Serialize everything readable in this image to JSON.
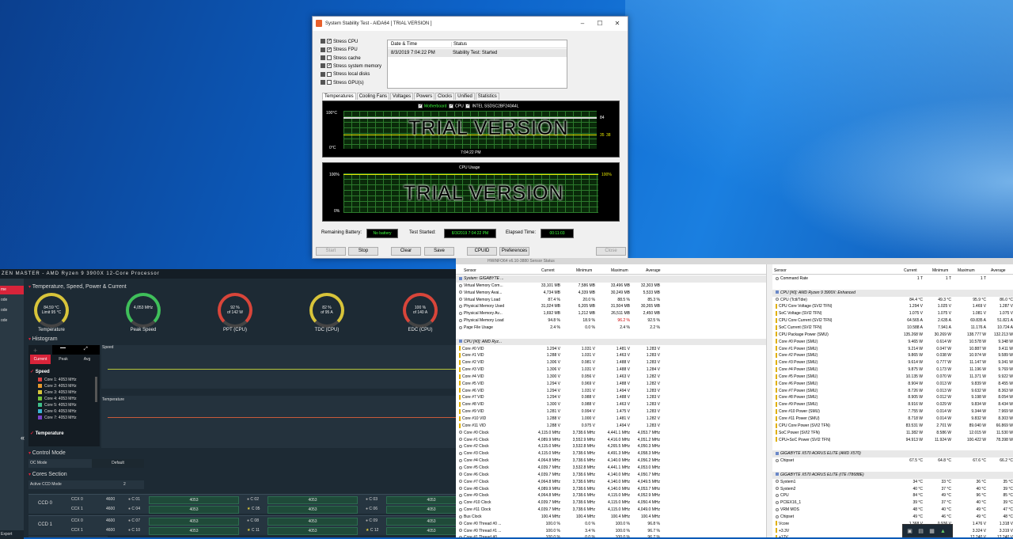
{
  "aida": {
    "title": "System Stability Test - AIDA64  [ TRIAL VERSION ]",
    "stress": [
      {
        "label": "Stress CPU",
        "checked": true
      },
      {
        "label": "Stress FPU",
        "checked": true
      },
      {
        "label": "Stress cache",
        "checked": false
      },
      {
        "label": "Stress system memory",
        "checked": true
      },
      {
        "label": "Stress local disks",
        "checked": false
      },
      {
        "label": "Stress GPU(s)",
        "checked": false
      }
    ],
    "log_headers": [
      "Date & Time",
      "Status"
    ],
    "log_rows": [
      [
        "8/3/2019 7:04:22 PM",
        "Stability Test: Started"
      ]
    ],
    "tabs": [
      "Temperatures",
      "Cooling Fans",
      "Voltages",
      "Powers",
      "Clocks",
      "Unified",
      "Statistics"
    ],
    "temp_legend": [
      "Motherboard",
      "CPU",
      "INTEL SSDSC2BF240A4L"
    ],
    "temp_top": "100°C",
    "temp_bottom": "0°C",
    "temp_time": "7:04:22 PM",
    "temp_vals": [
      "84",
      "35",
      "38"
    ],
    "trial": "TRIAL VERSION",
    "cpu_title": "CPU Usage",
    "cpu_top": "100%",
    "cpu_bottom": "0%",
    "cpu_right": "100%",
    "battery_label": "Remaining Battery:",
    "battery_val": "No battery",
    "started_label": "Test Started:",
    "started_val": "8/3/2019 7:04:22 PM",
    "elapsed_label": "Elapsed Time:",
    "elapsed_val": "00:11:03",
    "buttons": [
      "Start",
      "Stop",
      "Clear",
      "Save",
      "CPUID",
      "Preferences",
      "Close"
    ]
  },
  "rm": {
    "title": "ZEN MASTER  -  AMD Ryzen 9 3900X 12-Core Processor",
    "side": [
      "me",
      "ode",
      "ode",
      "ode"
    ],
    "side_bottom": "Export",
    "section_temp": "Temperature, Speed, Power & Current",
    "gauges": [
      {
        "v1": "84.59 °C",
        "v2": "Limit 95 °C",
        "cap": "Temperature",
        "color": "#d8c43a"
      },
      {
        "v1": "4,053  MHz",
        "v2": "",
        "cap": "Peak Speed",
        "color": "#3fbf5a"
      },
      {
        "v1": "92 %",
        "v2": "of 142 W",
        "cap": "PPT (CPU)",
        "color": "#d8453a"
      },
      {
        "v1": "82 %",
        "v2": "of 95 A",
        "cap": "TDC (CPU)",
        "color": "#d8c43a"
      },
      {
        "v1": "100 %",
        "v2": "of 140 A",
        "cap": "EDC (CPU)",
        "color": "#d8453a"
      }
    ],
    "section_hist": "Histogram",
    "hist_tabs": [
      "Current",
      "Peak",
      "Avg"
    ],
    "speed_label": "Speed",
    "cores": [
      {
        "name": "Core 1: 4053 MHz",
        "color": "#d94141"
      },
      {
        "name": "Core 2: 4053 MHz",
        "color": "#e69a2e"
      },
      {
        "name": "Core 3: 4053 MHz",
        "color": "#d9c53b"
      },
      {
        "name": "Core 4: 4053 MHz",
        "color": "#74c23c"
      },
      {
        "name": "Core 5: 4053 MHz",
        "color": "#3fbf8a"
      },
      {
        "name": "Core 6: 4053 MHz",
        "color": "#3ab5d1"
      },
      {
        "name": "Core 7: 4053 MHz",
        "color": "#7a45c9"
      }
    ],
    "temperature_label": "Temperature",
    "graph_speed": "Speed",
    "graph_temp": "Temperature",
    "section_control": "Control Mode",
    "oc_mode": "OC Mode",
    "oc_val": "Default",
    "section_cores": "Cores Section",
    "active_ccd": "Active CCD Mode",
    "active_ccd_val": "2",
    "ccd": [
      {
        "name": "CCD 0",
        "rows": [
          {
            "ccx": "CCX 0",
            "mhz": "4600",
            "cells": [
              [
                "C 01",
                "4053"
              ],
              [
                "C 02",
                "4053"
              ],
              [
                "C 03",
                "4053"
              ]
            ]
          },
          {
            "ccx": "CCX 1",
            "mhz": "4600",
            "cells": [
              [
                "C 04",
                "4053"
              ],
              [
                "C 05",
                "4053"
              ],
              [
                "C 06",
                "4053"
              ]
            ]
          }
        ]
      },
      {
        "name": "CCD 1",
        "rows": [
          {
            "ccx": "CCX 0",
            "mhz": "4600",
            "cells": [
              [
                "C 07",
                "4053"
              ],
              [
                "C 08",
                "4053"
              ],
              [
                "C 09",
                "4053"
              ]
            ]
          },
          {
            "ccx": "CCX 1",
            "mhz": "4600",
            "cells": [
              [
                "C 10",
                "4053"
              ],
              [
                "C 11",
                "4053"
              ],
              [
                "C 12",
                "4053"
              ]
            ]
          }
        ]
      }
    ]
  },
  "hw": {
    "title": "HWiNFO64 v6.10-3880 Sensor Status",
    "headers": [
      "Sensor",
      "Current",
      "Minimum",
      "Maximum",
      "Average"
    ],
    "left": [
      {
        "g": true,
        "n": "System: GIGABYTE ..."
      },
      {
        "i": "c",
        "n": "Virtual Memory Com...",
        "v": [
          "33,101 MB",
          "7,586 MB",
          "33,496 MB",
          "32,303 MB"
        ]
      },
      {
        "i": "c",
        "n": "Virtual Memory Avai...",
        "v": [
          "4,734 MB",
          "4,339 MB",
          "30,249 MB",
          "5,533 MB"
        ]
      },
      {
        "i": "c",
        "n": "Virtual Memory Load",
        "v": [
          "87.4 %",
          "20.0 %",
          "88.5 %",
          "85.3 %"
        ]
      },
      {
        "i": "c",
        "n": "Physical Memory Used",
        "v": [
          "31,024 MB",
          "6,205 MB",
          "31,504 MB",
          "30,265 MB"
        ]
      },
      {
        "i": "c",
        "n": "Physical Memory Av...",
        "v": [
          "1,692 MB",
          "1,212 MB",
          "26,511 MB",
          "2,450 MB"
        ]
      },
      {
        "i": "c",
        "n": "Physical Memory Load",
        "v": [
          "94.8 %",
          "18.9 %",
          "96.2 %",
          "92.5 %"
        ],
        "red": 2
      },
      {
        "i": "c",
        "n": "Page File Usage",
        "v": [
          "2.4 %",
          "0.0 %",
          "2.4 %",
          "2.2 %"
        ]
      },
      {
        "s": true
      },
      {
        "g": true,
        "n": "CPU [#0]: AMD Ryz..."
      },
      {
        "i": "y",
        "n": "Core #0 VID",
        "v": [
          "1.294 V",
          "1.031 V",
          "1.481 V",
          "1.283 V"
        ]
      },
      {
        "i": "y",
        "n": "Core #1 VID",
        "v": [
          "1.288 V",
          "1.031 V",
          "1.463 V",
          "1.283 V"
        ]
      },
      {
        "i": "y",
        "n": "Core #2 VID",
        "v": [
          "1.306 V",
          "0.981 V",
          "1.488 V",
          "1.283 V"
        ]
      },
      {
        "i": "y",
        "n": "Core #3 VID",
        "v": [
          "1.306 V",
          "1.031 V",
          "1.488 V",
          "1.284 V"
        ]
      },
      {
        "i": "y",
        "n": "Core #4 VID",
        "v": [
          "1.300 V",
          "0.956 V",
          "1.463 V",
          "1.282 V"
        ]
      },
      {
        "i": "y",
        "n": "Core #5 VID",
        "v": [
          "1.294 V",
          "0.969 V",
          "1.488 V",
          "1.282 V"
        ]
      },
      {
        "i": "y",
        "n": "Core #6 VID",
        "v": [
          "1.294 V",
          "1.031 V",
          "1.494 V",
          "1.283 V"
        ]
      },
      {
        "i": "y",
        "n": "Core #7 VID",
        "v": [
          "1.294 V",
          "0.988 V",
          "1.488 V",
          "1.283 V"
        ]
      },
      {
        "i": "y",
        "n": "Core #8 VID",
        "v": [
          "1.300 V",
          "0.988 V",
          "1.463 V",
          "1.283 V"
        ]
      },
      {
        "i": "y",
        "n": "Core #9 VID",
        "v": [
          "1.281 V",
          "0.994 V",
          "1.475 V",
          "1.283 V"
        ]
      },
      {
        "i": "y",
        "n": "Core #10 VID",
        "v": [
          "1.288 V",
          "1.000 V",
          "1.481 V",
          "1.282 V"
        ]
      },
      {
        "i": "y",
        "n": "Core #11 VID",
        "v": [
          "1.288 V",
          "0.975 V",
          "1.494 V",
          "1.283 V"
        ]
      },
      {
        "i": "c",
        "n": "Core #0 Clock",
        "v": [
          "4,115.0 MHz",
          "3,738.6 MHz",
          "4,441.1 MHz",
          "4,053.7 MHz"
        ]
      },
      {
        "i": "c",
        "n": "Core #1 Clock",
        "v": [
          "4,089.9 MHz",
          "3,552.9 MHz",
          "4,416.0 MHz",
          "4,051.2 MHz"
        ]
      },
      {
        "i": "c",
        "n": "Core #2 Clock",
        "v": [
          "4,115.0 MHz",
          "3,532.8 MHz",
          "4,265.5 MHz",
          "4,050.3 MHz"
        ]
      },
      {
        "i": "c",
        "n": "Core #3 Clock",
        "v": [
          "4,115.0 MHz",
          "3,738.6 MHz",
          "4,491.3 MHz",
          "4,058.3 MHz"
        ]
      },
      {
        "i": "c",
        "n": "Core #4 Clock",
        "v": [
          "4,064.8 MHz",
          "3,738.6 MHz",
          "4,140.0 MHz",
          "4,056.2 MHz"
        ]
      },
      {
        "i": "c",
        "n": "Core #5 Clock",
        "v": [
          "4,039.7 MHz",
          "3,532.8 MHz",
          "4,441.1 MHz",
          "4,053.0 MHz"
        ]
      },
      {
        "i": "c",
        "n": "Core #6 Clock",
        "v": [
          "4,039.7 MHz",
          "3,738.6 MHz",
          "4,140.0 MHz",
          "4,050.7 MHz"
        ]
      },
      {
        "i": "c",
        "n": "Core #7 Clock",
        "v": [
          "4,064.8 MHz",
          "3,738.6 MHz",
          "4,140.0 MHz",
          "4,049.5 MHz"
        ]
      },
      {
        "i": "c",
        "n": "Core #8 Clock",
        "v": [
          "4,089.9 MHz",
          "3,738.6 MHz",
          "4,140.0 MHz",
          "4,053.7 MHz"
        ]
      },
      {
        "i": "c",
        "n": "Core #9 Clock",
        "v": [
          "4,064.8 MHz",
          "3,738.6 MHz",
          "4,115.0 MHz",
          "4,052.9 MHz"
        ]
      },
      {
        "i": "c",
        "n": "Core #10 Clock",
        "v": [
          "4,039.7 MHz",
          "3,738.6 MHz",
          "4,115.0 MHz",
          "4,050.4 MHz"
        ]
      },
      {
        "i": "c",
        "n": "Core #11 Clock",
        "v": [
          "4,039.7 MHz",
          "3,738.6 MHz",
          "4,115.0 MHz",
          "4,049.0 MHz"
        ]
      },
      {
        "i": "c",
        "n": "Bus Clock",
        "v": [
          "100.4 MHz",
          "100.4 MHz",
          "100.4 MHz",
          "100.4 MHz"
        ]
      },
      {
        "i": "c",
        "n": "Core #0 Thread #0 ...",
        "v": [
          "100.0 %",
          "0.0 %",
          "100.0 %",
          "96.8 %"
        ]
      },
      {
        "i": "c",
        "n": "Core #0 Thread #1 ...",
        "v": [
          "100.0 %",
          "3.4 %",
          "100.0 %",
          "96.7 %"
        ]
      },
      {
        "i": "c",
        "n": "Core #1 Thread #0 ...",
        "v": [
          "100.0 %",
          "0.0 %",
          "100.0 %",
          "96.7 %"
        ]
      }
    ],
    "right": [
      {
        "i": "c",
        "n": "Command Rate",
        "v": [
          "1 T",
          "1 T",
          "1 T",
          ""
        ]
      },
      {
        "s": true
      },
      {
        "g": true,
        "n": "CPU [#0]: AMD Ryzen 9 3900X: Enhanced"
      },
      {
        "i": "c",
        "n": "CPU (Tctl/Tdie)",
        "v": [
          "84.4 °C",
          "49.3 °C",
          "95.9 °C",
          "86.0 °C"
        ]
      },
      {
        "i": "y",
        "n": "CPU Core Voltage (SVI2 TFN)",
        "v": [
          "1.294 V",
          "1.025 V",
          "1.469 V",
          "1.287 V"
        ]
      },
      {
        "i": "y",
        "n": "SoC Voltage (SVI2 TFN)",
        "v": [
          "1.075 V",
          "1.075 V",
          "1.081 V",
          "1.075 V"
        ]
      },
      {
        "i": "y",
        "n": "CPU Core Current (SVI2 TFN)",
        "v": [
          "64.565 A",
          "2.635 A",
          "69.835 A",
          "51.821 A"
        ]
      },
      {
        "i": "y",
        "n": "SoC Current (SVI2 TFN)",
        "v": [
          "10.588 A",
          "7.941 A",
          "11.176 A",
          "10.724 A"
        ]
      },
      {
        "i": "y",
        "n": "CPU Package Power (SMU)",
        "v": [
          "135.268 W",
          "30.269 W",
          "138.777 W",
          "132.213 W"
        ]
      },
      {
        "i": "y",
        "n": "Core #0 Power (SMU)",
        "v": [
          "9.465 W",
          "0.614 W",
          "10.578 W",
          "9.348 W"
        ]
      },
      {
        "i": "y",
        "n": "Core #1 Power (SMU)",
        "v": [
          "9.214 W",
          "0.047 W",
          "10.887 W",
          "9.411 W"
        ]
      },
      {
        "i": "y",
        "n": "Core #2 Power (SMU)",
        "v": [
          "9.865 W",
          "0.038 W",
          "10.974 W",
          "9.589 W"
        ]
      },
      {
        "i": "y",
        "n": "Core #3 Power (SMU)",
        "v": [
          "9.614 W",
          "0.777 W",
          "11.147 W",
          "9.341 W"
        ]
      },
      {
        "i": "y",
        "n": "Core #4 Power (SMU)",
        "v": [
          "9.875 W",
          "0.173 W",
          "11.196 W",
          "9.769 W"
        ]
      },
      {
        "i": "y",
        "n": "Core #5 Power (SMU)",
        "v": [
          "10.135 W",
          "0.070 W",
          "11.371 W",
          "9.922 W"
        ]
      },
      {
        "i": "y",
        "n": "Core #6 Power (SMU)",
        "v": [
          "8.904 W",
          "0.013 W",
          "9.839 W",
          "8.455 W"
        ]
      },
      {
        "i": "y",
        "n": "Core #7 Power (SMU)",
        "v": [
          "8.726 W",
          "0.013 W",
          "9.632 W",
          "8.363 W"
        ]
      },
      {
        "i": "y",
        "n": "Core #8 Power (SMU)",
        "v": [
          "8.905 W",
          "0.012 W",
          "9.198 W",
          "8.054 W"
        ]
      },
      {
        "i": "y",
        "n": "Core #9 Power (SMU)",
        "v": [
          "8.916 W",
          "0.029 W",
          "9.834 W",
          "8.434 W"
        ]
      },
      {
        "i": "y",
        "n": "Core #10 Power (SMU)",
        "v": [
          "7.755 W",
          "0.014 W",
          "9.344 W",
          "7.969 W"
        ]
      },
      {
        "i": "y",
        "n": "Core #11 Power (SMU)",
        "v": [
          "8.718 W",
          "0.014 W",
          "9.832 W",
          "8.303 W"
        ]
      },
      {
        "i": "y",
        "n": "CPU Core Power (SVI2 TFN)",
        "v": [
          "83.531 W",
          "2.701 W",
          "89.040 W",
          "66.869 W"
        ]
      },
      {
        "i": "y",
        "n": "SoC Power (SVI2 TFN)",
        "v": [
          "11.382 W",
          "8.586 W",
          "12.015 W",
          "11.530 W"
        ]
      },
      {
        "i": "y",
        "n": "CPU+SoC Power (SVI2 TFN)",
        "v": [
          "94.913 W",
          "11.924 W",
          "100.422 W",
          "78.398 W"
        ]
      },
      {
        "s": true
      },
      {
        "g": true,
        "n": "GIGABYTE X570 AORUS ELITE (AMD X570)"
      },
      {
        "i": "c",
        "n": "Chipset",
        "v": [
          "67.5 °C",
          "64.8 °C",
          "67.6 °C",
          "66.2 °C"
        ]
      },
      {
        "s": true
      },
      {
        "g": true,
        "n": "GIGABYTE X570 AORUS ELITE (ITE IT8688E)"
      },
      {
        "i": "c",
        "n": "System1",
        "v": [
          "34 °C",
          "33 °C",
          "36 °C",
          "35 °C"
        ]
      },
      {
        "i": "c",
        "n": "System2",
        "v": [
          "40 °C",
          "37 °C",
          "40 °C",
          "39 °C"
        ]
      },
      {
        "i": "c",
        "n": "CPU",
        "v": [
          "84 °C",
          "49 °C",
          "96 °C",
          "85 °C"
        ]
      },
      {
        "i": "c",
        "n": "PCIEX16_1",
        "v": [
          "39 °C",
          "37 °C",
          "40 °C",
          "39 °C"
        ]
      },
      {
        "i": "c",
        "n": "VRM MOS",
        "v": [
          "48 °C",
          "40 °C",
          "49 °C",
          "47 °C"
        ]
      },
      {
        "i": "c",
        "n": "Chipset",
        "v": [
          "49 °C",
          "46 °C",
          "49 °C",
          "48 °C"
        ]
      },
      {
        "i": "y",
        "n": "Vcore",
        "v": [
          "1.368 V",
          "0.936 V",
          "1.476 V",
          "1.318 V"
        ]
      },
      {
        "i": "y",
        "n": "+3.3V",
        "v": [
          "3.324 V",
          "3.324 V",
          "3.324 V",
          "3.319 V"
        ]
      },
      {
        "i": "y",
        "n": "+12V",
        "v": [
          "12.240 V",
          "12.240 V",
          "12.240 V",
          "12.240 V"
        ]
      }
    ]
  }
}
